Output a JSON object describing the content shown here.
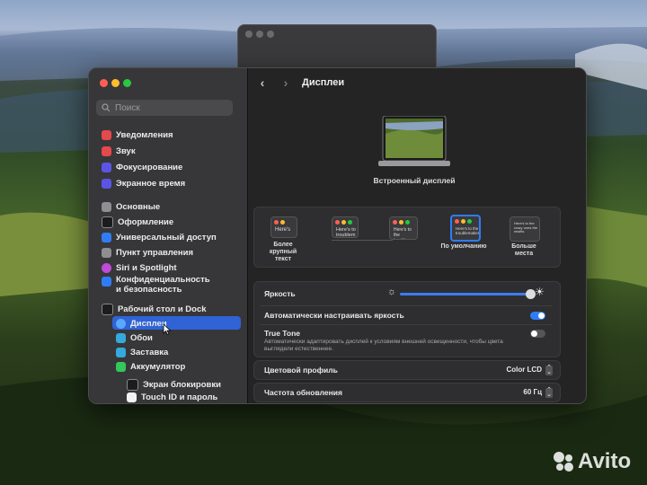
{
  "sidebar": {
    "search_placeholder": "Поиск",
    "items": [
      {
        "label": "Уведомления",
        "color": "#e5484d"
      },
      {
        "label": "Звук",
        "color": "#e5484d"
      },
      {
        "label": "Фокусирование",
        "color": "#5b55e6"
      },
      {
        "label": "Экранное время",
        "color": "#5b55e6"
      },
      {
        "label": "Основные",
        "color": "#8e8e93"
      },
      {
        "label": "Оформление",
        "color": "#1c1c1e"
      },
      {
        "label": "Универсальный доступ",
        "color": "#2f7cf6"
      },
      {
        "label": "Пункт управления",
        "color": "#8e8e93"
      },
      {
        "label": "Siri и Spotlight",
        "color": "#c04ad8"
      },
      {
        "label": "Конфиденциальность",
        "label2": "и безопасность",
        "color": "#2f7cf6"
      },
      {
        "label": "Рабочий стол и Dock",
        "color": "#1c1c1e"
      },
      {
        "label": "Дисплеи",
        "color": "#2f7cf6"
      },
      {
        "label": "Обои",
        "color": "#34aadc"
      },
      {
        "label": "Заставка",
        "color": "#34aadc"
      },
      {
        "label": "Аккумулятор",
        "color": "#34c759"
      },
      {
        "label": "Экран блокировки",
        "color": "#1c1c1e"
      },
      {
        "label": "Touch ID и пароль",
        "color": "#e5484d"
      }
    ]
  },
  "header": {
    "back": "‹",
    "forward": "›",
    "title": "Дисплеи"
  },
  "display_name": "Встроенный дисплей",
  "resolutions": [
    {
      "preview": "Here's",
      "label": "Более крупный текст"
    },
    {
      "preview": "Here's to troublem",
      "label": ""
    },
    {
      "preview": "Here's to the troublema",
      "label": ""
    },
    {
      "preview": "Here's to the troublemakers",
      "label": "По умолчанию"
    },
    {
      "preview": "Here's to the crazy ones the misfits",
      "label": "Больше места"
    }
  ],
  "brightness": {
    "label": "Яркость",
    "value": 0.92
  },
  "auto_brightness": {
    "label": "Автоматически настраивать яркость",
    "on": true
  },
  "true_tone": {
    "label": "True Tone",
    "desc": "Автоматически адаптировать дисплей к условиям внешней освещенности, чтобы цвета выглядели естественнее.",
    "on": false
  },
  "color_profile": {
    "label": "Цветовой профиль",
    "value": "Color LCD"
  },
  "refresh_rate": {
    "label": "Частота обновления",
    "value": "60 Гц"
  },
  "watermark": "Avito"
}
